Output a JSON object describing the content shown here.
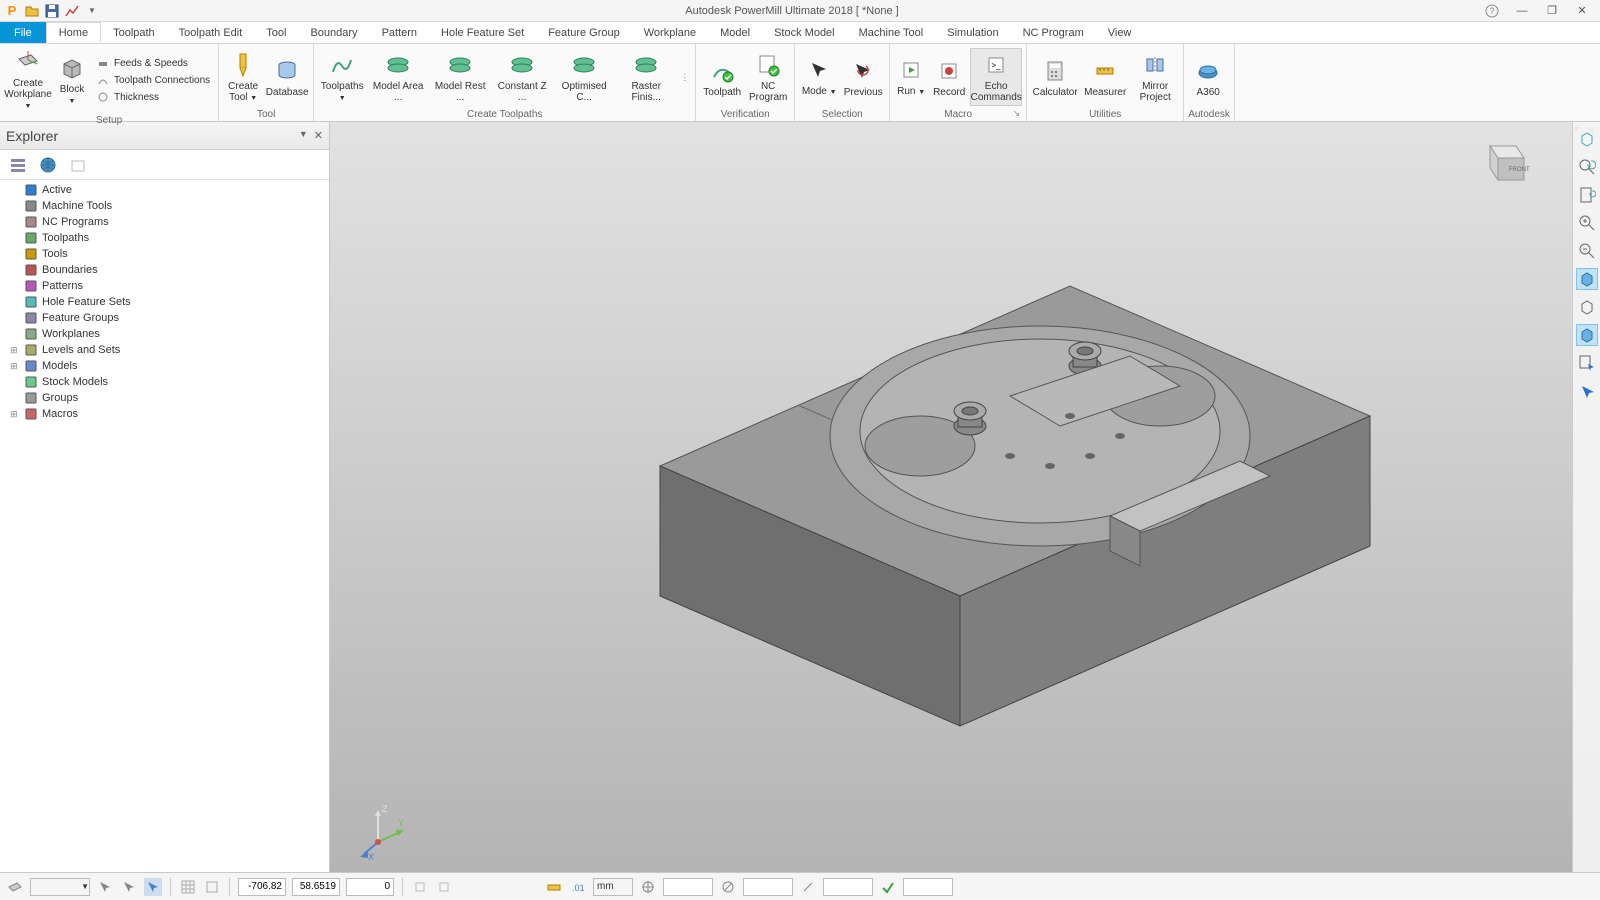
{
  "app_title": "Autodesk PowerMill Ultimate 2018    [ *None ]",
  "qat": [
    "P",
    "open",
    "save",
    "undo-red"
  ],
  "window_controls": {
    "help": "?",
    "min": "—",
    "max": "❐",
    "close": "✕"
  },
  "tabs": [
    "File",
    "Home",
    "Toolpath",
    "Toolpath Edit",
    "Tool",
    "Boundary",
    "Pattern",
    "Hole Feature Set",
    "Feature Group",
    "Workplane",
    "Model",
    "Stock Model",
    "Machine Tool",
    "Simulation",
    "NC Program",
    "View"
  ],
  "active_tab": 1,
  "ribbon": {
    "setup": {
      "label": "Setup",
      "create": "Create Workplane",
      "block": "Block",
      "small": [
        "Feeds & Speeds",
        "Toolpath Connections",
        "Thickness"
      ]
    },
    "tool": {
      "label": "Tool",
      "create": "Create Tool",
      "db": "Database"
    },
    "create_toolpaths": {
      "label": "Create Toolpaths",
      "big": "Toolpaths",
      "items": [
        "Model Area ...",
        "Model Rest ...",
        "Constant Z ...",
        "Optimised C...",
        "Raster Finis..."
      ]
    },
    "verification": {
      "label": "Verification",
      "toolpath": "Toolpath",
      "nc": "NC Program"
    },
    "selection": {
      "label": "Selection",
      "mode": "Mode",
      "previous": "Previous"
    },
    "macro": {
      "label": "Macro",
      "run": "Run",
      "record": "Record",
      "echo": "Echo Commands"
    },
    "utilities": {
      "label": "Utilities",
      "calc": "Calculator",
      "meas": "Measurer",
      "mirror": "Mirror Project"
    },
    "autodesk": {
      "label": "Autodesk",
      "a360": "A360"
    }
  },
  "explorer": {
    "title": "Explorer",
    "nodes": [
      {
        "icon": "play",
        "label": "Active",
        "color": "#2a7fd6"
      },
      {
        "icon": "machine",
        "label": "Machine Tools"
      },
      {
        "icon": "nc",
        "label": "NC Programs"
      },
      {
        "icon": "tp",
        "label": "Toolpaths"
      },
      {
        "icon": "tool",
        "label": "Tools"
      },
      {
        "icon": "bound",
        "label": "Boundaries"
      },
      {
        "icon": "patt",
        "label": "Patterns"
      },
      {
        "icon": "hole",
        "label": "Hole Feature Sets"
      },
      {
        "icon": "fg",
        "label": "Feature Groups"
      },
      {
        "icon": "wp",
        "label": "Workplanes"
      },
      {
        "icon": "lvl",
        "label": "Levels and Sets",
        "exp": "+"
      },
      {
        "icon": "mdl",
        "label": "Models",
        "exp": "+"
      },
      {
        "icon": "stock",
        "label": "Stock Models"
      },
      {
        "icon": "grp",
        "label": "Groups"
      },
      {
        "icon": "macro",
        "label": "Macros",
        "exp": "+"
      }
    ]
  },
  "status": {
    "coords": [
      "-706.82",
      "58.6519",
      "0"
    ],
    "unit": "mm"
  },
  "triad": {
    "x": "X",
    "y": "Y",
    "z": "Z"
  }
}
